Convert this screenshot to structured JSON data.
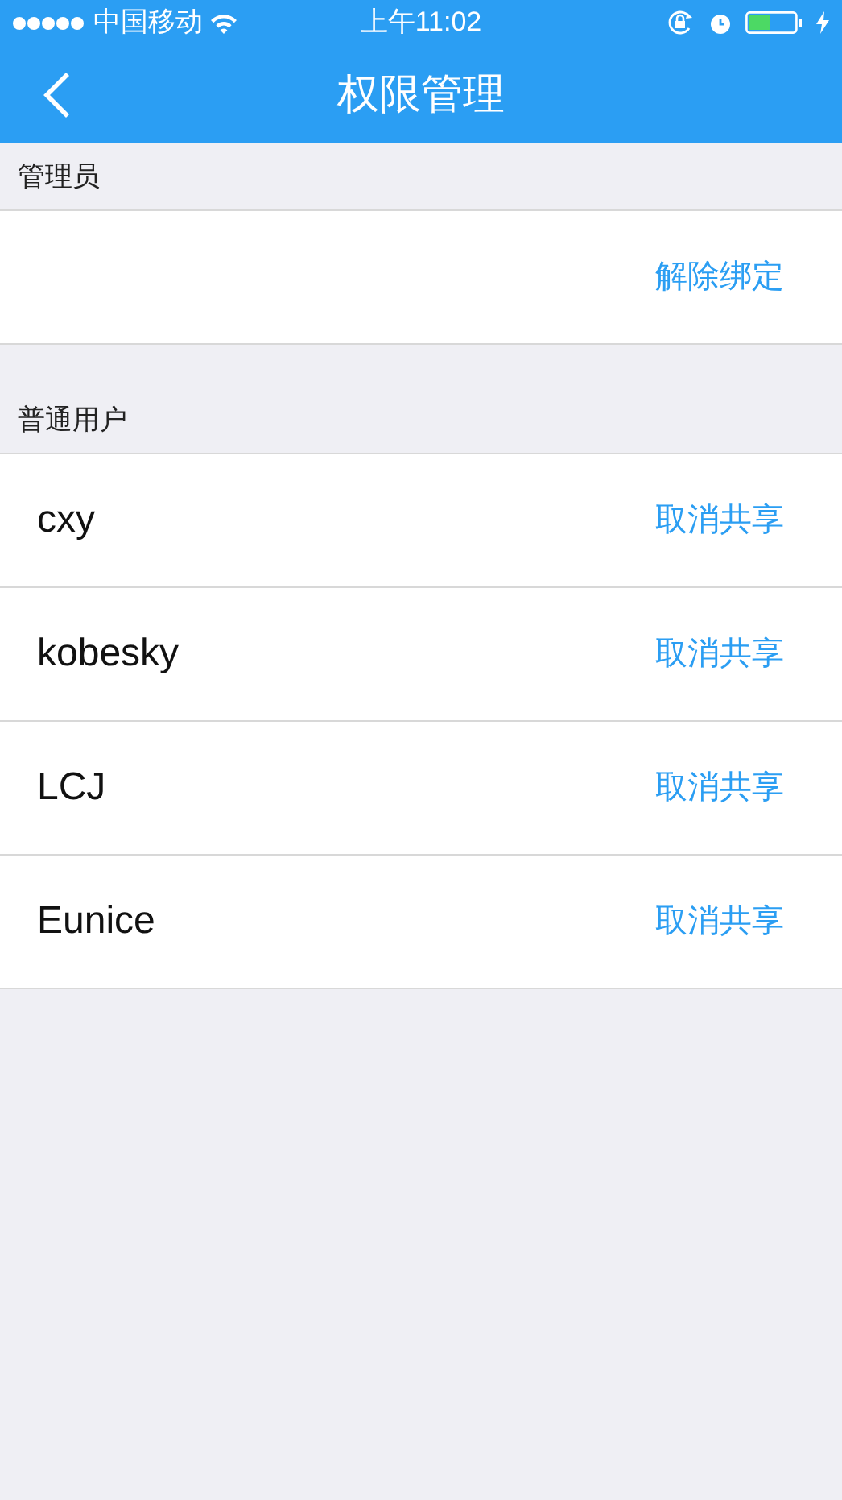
{
  "status_bar": {
    "carrier": "中国移动",
    "time": "上午11:02"
  },
  "nav": {
    "title": "权限管理"
  },
  "sections": [
    {
      "title": "管理员",
      "rows": [
        {
          "name": "",
          "action": "解除绑定"
        }
      ]
    },
    {
      "title": "普通用户",
      "rows": [
        {
          "name": "cxy",
          "action": "取消共享"
        },
        {
          "name": "kobesky",
          "action": "取消共享"
        },
        {
          "name": "LCJ",
          "action": "取消共享"
        },
        {
          "name": "Eunice",
          "action": "取消共享"
        }
      ]
    }
  ]
}
